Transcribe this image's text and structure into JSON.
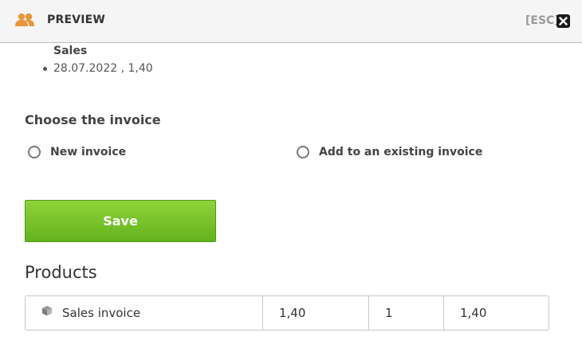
{
  "header": {
    "title": "PREVIEW",
    "esc_label": "[ESC]",
    "icon": "users-icon",
    "close_icon": "close-icon"
  },
  "sales": {
    "heading": "Sales",
    "items": [
      "28.07.2022 , 1,40"
    ]
  },
  "invoice_choice": {
    "title": "Choose the invoice",
    "options": [
      {
        "label": "New invoice",
        "selected": false
      },
      {
        "label": "Add to an existing invoice",
        "selected": false
      }
    ]
  },
  "save_label": "Save",
  "products": {
    "title": "Products",
    "rows": [
      {
        "icon": "box-icon",
        "name": "Sales invoice",
        "price": "1,40",
        "quantity": "1",
        "total": "1,40"
      }
    ]
  },
  "colors": {
    "accent_orange": "#e8963a",
    "save_green": "#7cc42e"
  }
}
